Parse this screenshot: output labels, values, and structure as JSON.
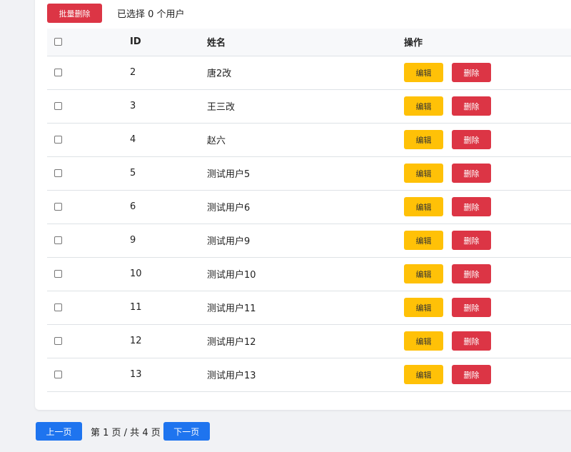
{
  "toolbar": {
    "bulk_delete_label": "批量删除",
    "selected_text": "已选择 0 个用户"
  },
  "table": {
    "headers": {
      "id": "ID",
      "name": "姓名",
      "actions": "操作"
    },
    "rows": [
      {
        "id": "2",
        "name": "唐2改",
        "edit_label": "编辑",
        "delete_label": "删除",
        "checked": false
      },
      {
        "id": "3",
        "name": "王三改",
        "edit_label": "编辑",
        "delete_label": "删除",
        "checked": false
      },
      {
        "id": "4",
        "name": "赵六",
        "edit_label": "编辑",
        "delete_label": "删除",
        "checked": false
      },
      {
        "id": "5",
        "name": "测试用户5",
        "edit_label": "编辑",
        "delete_label": "删除",
        "checked": false
      },
      {
        "id": "6",
        "name": "测试用户6",
        "edit_label": "编辑",
        "delete_label": "删除",
        "checked": false
      },
      {
        "id": "9",
        "name": "测试用户9",
        "edit_label": "编辑",
        "delete_label": "删除",
        "checked": false
      },
      {
        "id": "10",
        "name": "测试用户10",
        "edit_label": "编辑",
        "delete_label": "删除",
        "checked": false
      },
      {
        "id": "11",
        "name": "测试用户11",
        "edit_label": "编辑",
        "delete_label": "删除",
        "checked": false
      },
      {
        "id": "12",
        "name": "测试用户12",
        "edit_label": "编辑",
        "delete_label": "删除",
        "checked": false
      },
      {
        "id": "13",
        "name": "测试用户13",
        "edit_label": "编辑",
        "delete_label": "删除",
        "checked": false
      }
    ]
  },
  "pager": {
    "prev_label": "上一页",
    "info": "第 1 页 / 共 4 页",
    "next_label": "下一页"
  },
  "colors": {
    "danger": "#dc3545",
    "warning": "#ffc107",
    "primary": "#1e74ef",
    "page_bg": "#f1f2f5"
  }
}
